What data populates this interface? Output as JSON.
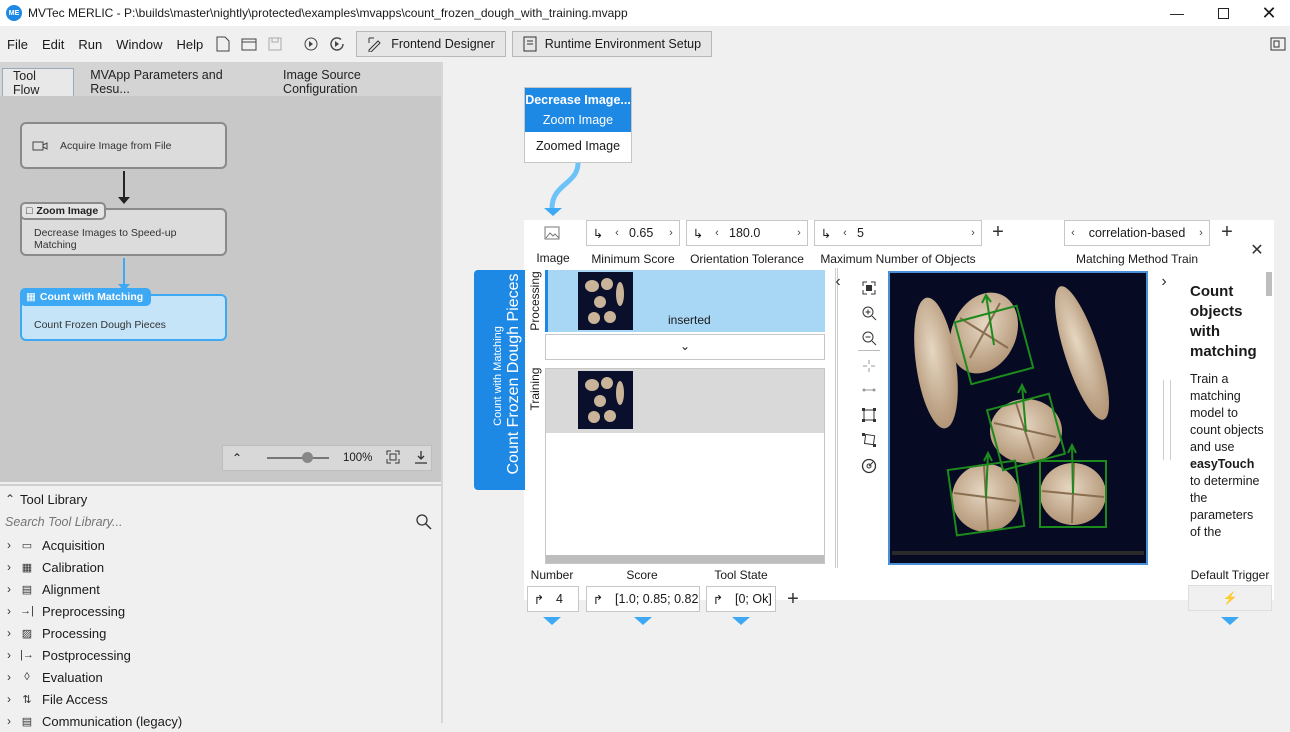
{
  "window": {
    "title": "MVTec MERLIC - P:\\builds\\master\\nightly\\protected\\examples\\mvapps\\count_frozen_dough_with_training.mvapp",
    "logo_text": "ME"
  },
  "menu": {
    "items": [
      "File",
      "Edit",
      "Run",
      "Window",
      "Help"
    ],
    "frontend_designer": "Frontend Designer",
    "runtime_setup": "Runtime Environment Setup"
  },
  "tabs": [
    "Tool Flow",
    "MVApp Parameters and Resu...",
    "Image Source Configuration"
  ],
  "flow": {
    "acquire": "Acquire Image from File",
    "zoom_tag": "Zoom Image",
    "zoom_desc": "Decrease Images to Speed-up Matching",
    "count_tag": "Count with Matching",
    "count_desc": "Count Frozen Dough Pieces",
    "zoom_level": "100%"
  },
  "library": {
    "header": "Tool Library",
    "search_placeholder": "Search Tool Library...",
    "categories": [
      "Acquisition",
      "Calibration",
      "Alignment",
      "Preprocessing",
      "Processing",
      "Postprocessing",
      "Evaluation",
      "File Access",
      "Communication (legacy)"
    ]
  },
  "source_tool": {
    "title": "Decrease Image...",
    "subtitle": "Zoom Image",
    "output": "Zoomed Image"
  },
  "tool": {
    "side_small": "Count with Matching",
    "side_large": "Count Frozen Dough Pieces",
    "params": {
      "image_label": "Image",
      "min_score_value": "0.65",
      "min_score_label": "Minimum Score",
      "orient_value": "180.0",
      "orient_label": "Orientation Tolerance",
      "max_obj_value": "5",
      "max_obj_label": "Maximum Number of Objects",
      "method_value": "correlation-based",
      "method_label": "Matching Method Train"
    },
    "processing_label": "Processing",
    "training_label": "Training",
    "inserted": "inserted",
    "help": {
      "title": "Count objects with matching",
      "body_pre": "Train a matching model to count objects and use",
      "body_bold": "easyTouch",
      "body_post": "to determine the parameters of the"
    },
    "results": {
      "number_label": "Number",
      "number_value": "4",
      "score_label": "Score",
      "score_value": "[1.0; 0.85; 0.82",
      "state_label": "Tool State",
      "state_value": "[0; Ok]",
      "trigger_label": "Default Trigger"
    }
  },
  "colors": {
    "accent": "#3da9f5",
    "tool_blue": "#1e88e5",
    "selection": "#a8d6f5",
    "match_box": "#1d8a1d"
  }
}
